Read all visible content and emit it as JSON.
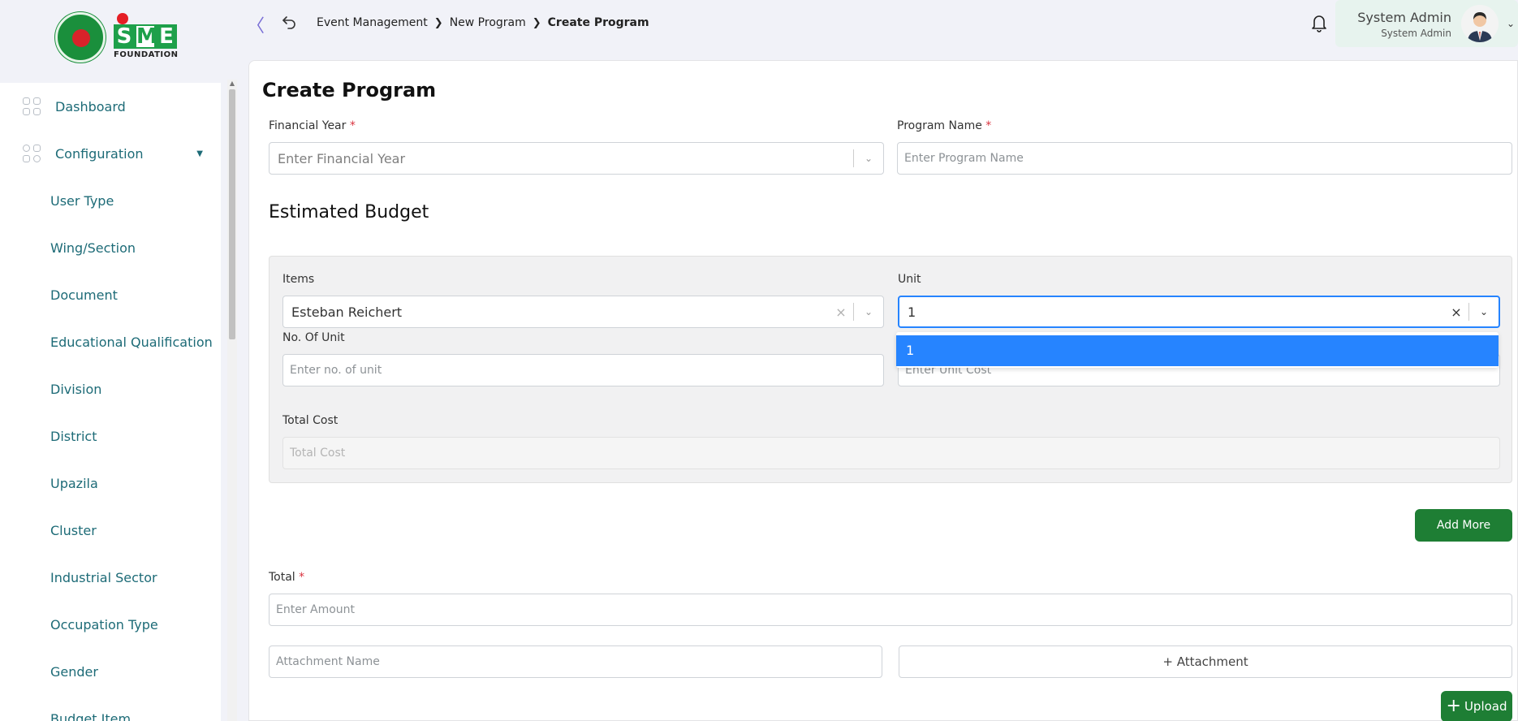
{
  "brand": {
    "logo_letters": [
      "S",
      "M",
      "E"
    ],
    "logo_sub": "FOUNDATION",
    "green": "#1ea04a",
    "red": "#e51e25"
  },
  "sidebar": {
    "items": [
      {
        "label": "Dashboard",
        "icon": "grid-icon"
      },
      {
        "label": "Configuration",
        "icon": "config-icon"
      }
    ],
    "sub_items": [
      "User Type",
      "Wing/Section",
      "Document",
      "Educational Qualification",
      "Division",
      "District",
      "Upazila",
      "Cluster",
      "Industrial Sector",
      "Occupation Type",
      "Gender",
      "Budget Item"
    ]
  },
  "header": {
    "breadcrumb": [
      "Event Management",
      "New Program",
      "Create Program"
    ],
    "user_name": "System Admin",
    "user_role": "System Admin"
  },
  "form": {
    "title": "Create Program",
    "financial_year_label": "Financial Year",
    "financial_year_placeholder": "Enter Financial Year",
    "program_name_label": "Program Name",
    "program_name_placeholder": "Enter Program Name",
    "budget_title": "Estimated Budget",
    "items_label": "Items",
    "items_value": "Esteban Reichert",
    "unit_label": "Unit",
    "unit_value": "1",
    "unit_option": "1",
    "no_of_unit_label": "No. Of Unit",
    "no_of_unit_placeholder": "Enter no. of unit",
    "unit_cost_placeholder": "Enter Unit Cost",
    "total_cost_label": "Total Cost",
    "total_cost_placeholder": "Total Cost",
    "add_more_label": "Add More",
    "total_label": "Total",
    "total_placeholder": "Enter Amount",
    "attachment_name_placeholder": "Attachment Name",
    "attachment_button_label": "+ Attachment",
    "upload_label": "Upload",
    "required_mark": "*"
  }
}
